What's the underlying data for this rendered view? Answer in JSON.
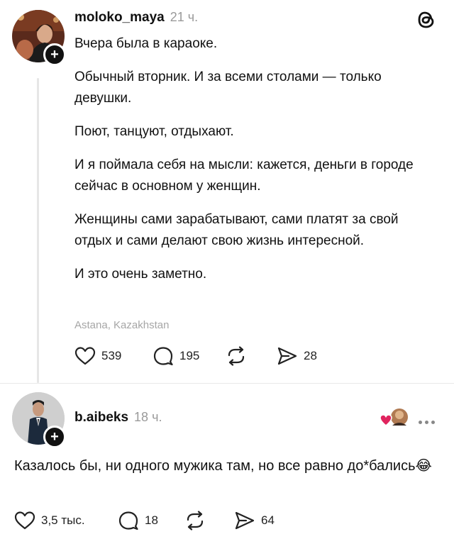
{
  "post": {
    "username": "moloko_maya",
    "time": "21 ч.",
    "paragraphs": [
      "Вчера была в караоке.",
      "Обычный вторник. И за всеми столами — только девушки.",
      "Поют, танцуют, отдыхают.",
      "И я поймала себя на мысли: кажется, деньги в городе сейчас в основном у женщин.",
      "Женщины сами зарабатывают, сами платят за свой отдых и сами делают свою жизнь интересной.",
      "И это очень заметно."
    ],
    "location": "Astana, Kazakhstan",
    "likes": "539",
    "comments": "195",
    "shares": "28"
  },
  "reply": {
    "username": "b.aibeks",
    "time": "18 ч.",
    "text": "Казалось бы, ни одного мужика там, но все равно до*бались",
    "emoji": "😂",
    "likes": "3,5 тыс.",
    "comments": "18",
    "shares": "64"
  },
  "icons": {
    "app": "threads-icon",
    "like": "heart-icon",
    "comment": "comment-icon",
    "repost": "repost-icon",
    "share": "send-icon"
  },
  "colors": {
    "text": "#111111",
    "muted": "#9a9a9a",
    "heart_red": "#e0245e"
  }
}
